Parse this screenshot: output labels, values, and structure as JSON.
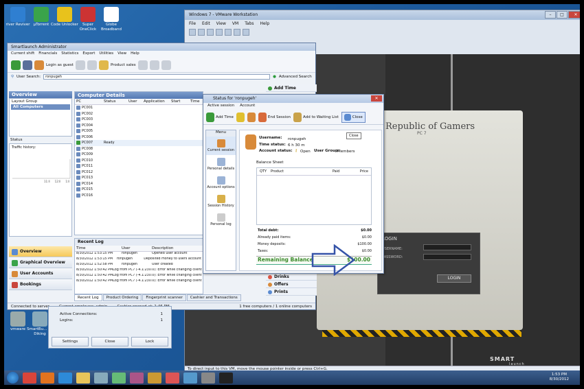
{
  "desktop": {
    "icons": [
      {
        "label": "river Reviver",
        "color": "#2f7fd1"
      },
      {
        "label": "µTorrent",
        "color": "#3aa34a"
      },
      {
        "label": "Code Unlocker",
        "color": "#e8c21c"
      },
      {
        "label": "Super OneClick",
        "color": "#cc3333"
      },
      {
        "label": "Globe Broadband",
        "color": "#ffffff"
      }
    ],
    "lower_icons": [
      {
        "label": "vmware",
        "color": "#9aa"
      },
      {
        "label": "SmartBu... by Diking",
        "color": "#8ab"
      }
    ]
  },
  "vmware": {
    "title": "Windows 7 - VMware Workstation",
    "menu": [
      "File",
      "Edit",
      "View",
      "VM",
      "Tabs",
      "Help"
    ],
    "status_text": "To direct input to this VM, move the mouse pointer inside or press Ctrl+G.",
    "guest": {
      "brand_title": "Republic of Gamers",
      "pc_label": "PC 7",
      "login_header": "LOGIN",
      "username_label": "USERNAME:",
      "password_label": "PASSWORD:",
      "login_button": "LOGIN",
      "logo": "SMART",
      "logo_sub": "launch"
    }
  },
  "admin": {
    "title": "Smartlaunch Administrator",
    "menu": [
      "Current shift",
      "Financials",
      "Statistics",
      "Export",
      "Utilities",
      "View",
      "Help"
    ],
    "toolbar": {
      "login_guest": "Login as guest",
      "product_sales": "Product sales"
    },
    "search": {
      "label": "User Search:",
      "value": "ronpugeh",
      "advanced": "Advanced Search"
    },
    "overview": {
      "head": "Overview",
      "layout_group": "Layout Group",
      "all_computers": "All Computers",
      "status_label": "Status",
      "traffic_label": "Traffic history:",
      "traffic_ticks": [
        "11:ll",
        "12:ll",
        "1:ll"
      ]
    },
    "nav": [
      "Overview",
      "Graphical Overview",
      "User Accounts",
      "Bookings"
    ],
    "computer_details": {
      "head": "Computer Details",
      "columns": [
        "PC",
        "Status",
        "User",
        "Application",
        "Start",
        "Time"
      ],
      "rows": [
        {
          "pc": "PC001",
          "status": ""
        },
        {
          "pc": "PC002",
          "status": ""
        },
        {
          "pc": "PC003",
          "status": ""
        },
        {
          "pc": "PC004",
          "status": ""
        },
        {
          "pc": "PC005",
          "status": ""
        },
        {
          "pc": "PC006",
          "status": ""
        },
        {
          "pc": "PC007",
          "status": "Ready"
        },
        {
          "pc": "PC008",
          "status": ""
        },
        {
          "pc": "PC009",
          "status": ""
        },
        {
          "pc": "PC010",
          "status": ""
        },
        {
          "pc": "PC011",
          "status": ""
        },
        {
          "pc": "PC012",
          "status": ""
        },
        {
          "pc": "PC013",
          "status": ""
        },
        {
          "pc": "PC014",
          "status": ""
        },
        {
          "pc": "PC015",
          "status": ""
        },
        {
          "pc": "PC016",
          "status": ""
        }
      ]
    },
    "recent_log": {
      "head": "Recent Log",
      "columns": [
        "Time",
        "User",
        "Description"
      ],
      "rows": [
        {
          "time": "8/30/2012 1:53:15 PM",
          "user": "ronpugeh",
          "desc": "Opened user account"
        },
        {
          "time": "8/30/2012 1:53:15 PM",
          "user": "ronpugeh",
          "desc": "Deposited money to users account"
        },
        {
          "time": "8/30/2012 1:52:58 PM",
          "user": "ronpugeh",
          "desc": "User created"
        },
        {
          "time": "8/30/2012 1:50:42 PM",
          "user": "",
          "desc": "Log from PC7 (-4.1:230.0): Error while changing client security sett..."
        },
        {
          "time": "8/30/2012 1:50:42 PM",
          "user": "",
          "desc": "Log from PC7 (-4.1:230.0): Error while changing client security sett..."
        },
        {
          "time": "8/30/2012 1:50:42 PM",
          "user": "",
          "desc": "Log from PC7 (-4.1:230.0): Error while changing client security sett..."
        }
      ]
    },
    "bottom_tabs": [
      "Recent Log",
      "Product Ordering",
      "Fingerprint scanner",
      "Cashier and Transactions"
    ],
    "right_menu": [
      "Add Time",
      "Drinks",
      "Offers",
      "Prints"
    ],
    "status_bar": {
      "connected": "Connected to server",
      "employee": "Current employee: admin",
      "cashier": "Cashier opened at: 1:46 PM",
      "computers": "1 free computers / 1 online computers"
    }
  },
  "status_dialog": {
    "title": "Status for 'ronpugeh'",
    "tabs": [
      "Active session",
      "Account"
    ],
    "toolbar": [
      "Add Time",
      "End Session",
      "Add to Waiting List",
      "Close"
    ],
    "tooltip": "Close",
    "menu_head": "Menu",
    "menu_items": [
      "Current session",
      "Personal details",
      "Account options",
      "Session History",
      "Personal log"
    ],
    "user": {
      "username_label": "Username:",
      "username": "ronpugeh",
      "time_label": "Time status:",
      "time": "6 h 30 m",
      "account_label": "Account status:",
      "account": "Open",
      "group_label": "User Group:",
      "group": "Members"
    },
    "balance_sheet": {
      "head": "Balance Sheet",
      "columns": [
        "QTY",
        "Product",
        "Paid",
        "Price"
      ],
      "total_debt_label": "Total debt:",
      "total_debt": "$0.00",
      "paid_label": "Already paid items:",
      "paid": "$0.00",
      "deposits_label": "Money deposits:",
      "deposits": "$100.00",
      "taxes_label": "Taxes:",
      "taxes": "$0.00",
      "remaining_label": "Remaining Balance",
      "remaining": "$100.00"
    }
  },
  "vbox_panel": {
    "active_label": "Active Connections:",
    "active": "1",
    "logins_label": "Logins:",
    "logins": "1",
    "buttons": [
      "Settings",
      "Close",
      "Lock"
    ]
  },
  "taskbar": {
    "time": "1:53 PM",
    "date": "8/30/2012",
    "apps": [
      {
        "name": "chrome",
        "color": "#d9453a"
      },
      {
        "name": "firefox",
        "color": "#e2731f"
      },
      {
        "name": "ie",
        "color": "#2d8ad8"
      },
      {
        "name": "explorer",
        "color": "#e8c45a"
      },
      {
        "name": "app5",
        "color": "#8ab"
      },
      {
        "name": "app6",
        "color": "#6b7"
      },
      {
        "name": "app7",
        "color": "#a58"
      },
      {
        "name": "app8",
        "color": "#c93"
      },
      {
        "name": "smartlaunch",
        "color": "#d55"
      },
      {
        "name": "app10",
        "color": "#59c"
      },
      {
        "name": "vmware",
        "color": "#888"
      },
      {
        "name": "cmd",
        "color": "#222"
      }
    ]
  },
  "colors": {
    "accent": "#5479b3",
    "green": "#3a8a2a",
    "arrow": "#3553a8"
  }
}
